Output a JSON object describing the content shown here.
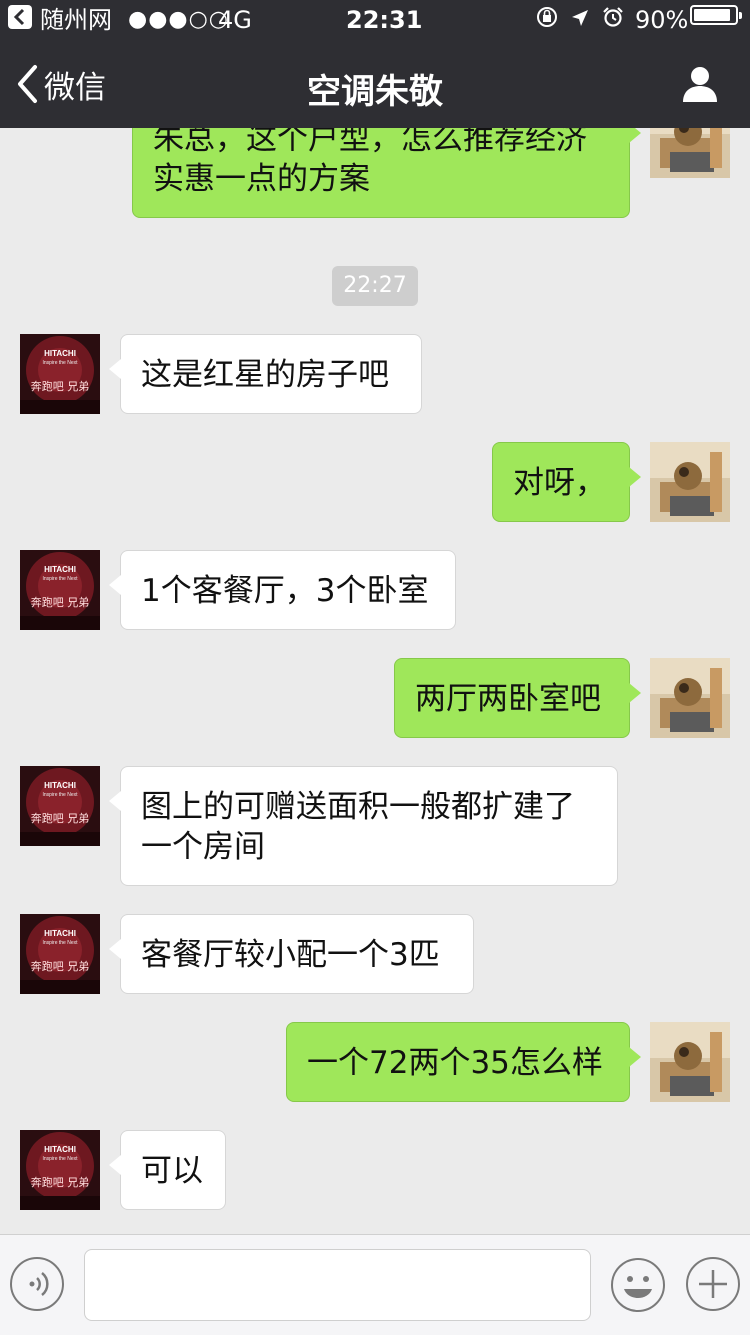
{
  "status_bar": {
    "carrier": "随州网",
    "signal": "●●●○○",
    "network": "4G",
    "time": "22:31",
    "battery_percent": "90%",
    "battery_level": 0.9
  },
  "nav": {
    "back_label": "微信",
    "title": "空调朱敬"
  },
  "chat": {
    "timestamp": "22:27",
    "messages": [
      {
        "sender": "self",
        "text": "朱总，这个户型，怎么推荐经济实惠一点的方案"
      },
      {
        "sender": "other",
        "text": "这是红星的房子吧"
      },
      {
        "sender": "self",
        "text": "对呀，"
      },
      {
        "sender": "other",
        "text": "1个客餐厅，3个卧室"
      },
      {
        "sender": "self",
        "text": "两厅两卧室吧"
      },
      {
        "sender": "other",
        "text": "图上的可赠送面积一般都扩建了一个房间"
      },
      {
        "sender": "other",
        "text": "客餐厅较小配一个3匹"
      },
      {
        "sender": "self",
        "text": "一个72两个35怎么样"
      },
      {
        "sender": "other",
        "text": "可以"
      }
    ]
  },
  "other_avatar": {
    "brand": "HITACHI",
    "tagline": "Inspire the Next",
    "caption": "奔跑吧 兄弟"
  },
  "colors": {
    "bar_bg": "#2e2e33",
    "self_bubble": "#9fe75a",
    "other_bubble": "#ffffff",
    "chat_bg": "#ebebeb"
  },
  "icons": {
    "back": "chevron-left-icon",
    "profile": "person-icon",
    "voice": "voice-icon",
    "emoji": "emoji-icon",
    "more": "plus-icon"
  }
}
